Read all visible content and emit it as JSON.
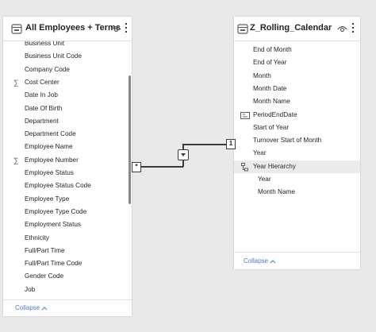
{
  "left_table": {
    "title": "All Employees + Terms",
    "fields": [
      {
        "label": "Business Unit",
        "sigma": false
      },
      {
        "label": "Business Unit Code",
        "sigma": false
      },
      {
        "label": "Company Code",
        "sigma": false
      },
      {
        "label": "Cost Center",
        "sigma": true
      },
      {
        "label": "Date In Job",
        "sigma": false
      },
      {
        "label": "Date Of Birth",
        "sigma": false
      },
      {
        "label": "Department",
        "sigma": false
      },
      {
        "label": "Department Code",
        "sigma": false
      },
      {
        "label": "Employee Name",
        "sigma": false
      },
      {
        "label": "Employee Number",
        "sigma": true
      },
      {
        "label": "Employee Status",
        "sigma": false
      },
      {
        "label": "Employee Status Code",
        "sigma": false
      },
      {
        "label": "Employee Type",
        "sigma": false
      },
      {
        "label": "Employee Type Code",
        "sigma": false
      },
      {
        "label": "Employment Status",
        "sigma": false
      },
      {
        "label": "Ethnicity",
        "sigma": false
      },
      {
        "label": "Full/Part Time",
        "sigma": false
      },
      {
        "label": "Full/Part Time Code",
        "sigma": false
      },
      {
        "label": "Gender Code",
        "sigma": false
      },
      {
        "label": "Job",
        "sigma": false
      }
    ],
    "collapse_label": "Collapse"
  },
  "right_table": {
    "title": "Z_Rolling_Calendar",
    "fields": [
      {
        "label": "End of Month",
        "icon": ""
      },
      {
        "label": "End of Year",
        "icon": ""
      },
      {
        "label": "Month",
        "icon": ""
      },
      {
        "label": "Month Date",
        "icon": ""
      },
      {
        "label": "Month Name",
        "icon": ""
      },
      {
        "label": "PeriodEndDate",
        "icon": "calculated-column-icon"
      },
      {
        "label": "Start of Year",
        "icon": ""
      },
      {
        "label": "Turnover Start of Month",
        "icon": ""
      },
      {
        "label": "Year",
        "icon": ""
      },
      {
        "label": "Year Hierarchy",
        "icon": "hierarchy-icon"
      },
      {
        "label": "Year",
        "icon": "",
        "indent": true
      },
      {
        "label": "Month Name",
        "icon": "",
        "indent": true
      }
    ],
    "collapse_label": "Collapse"
  },
  "relationship": {
    "many_label": "*",
    "one_label": "1"
  },
  "colors": {
    "canvas": "#e9e9e9",
    "card": "#ffffff",
    "link": "#4a7bbf",
    "line": "#3b3a39"
  }
}
